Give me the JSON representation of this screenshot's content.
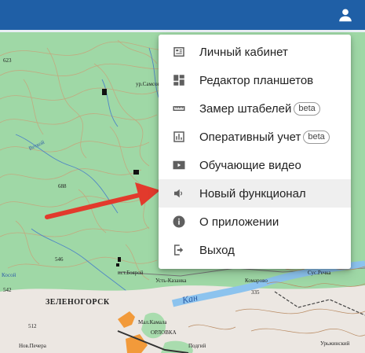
{
  "header": {
    "account_icon": "account-circle-icon",
    "color": "#1f5fa6"
  },
  "menu": {
    "items": [
      {
        "label": "Личный кабинет",
        "icon": "account-card-icon"
      },
      {
        "label": "Редактор планшетов",
        "icon": "dashboard-icon"
      },
      {
        "label": "Замер штабелей",
        "icon": "ruler-icon",
        "badge": "beta"
      },
      {
        "label": "Оперативный учет",
        "icon": "bar-chart-icon",
        "badge": "beta"
      },
      {
        "label": "Обучающие видео",
        "icon": "video-play-icon"
      },
      {
        "label": "Новый функционал",
        "icon": "volume-icon",
        "highlighted": true
      },
      {
        "label": "О приложении",
        "icon": "info-icon"
      },
      {
        "label": "Выход",
        "icon": "logout-icon"
      }
    ]
  },
  "map": {
    "labels": {
      "num_623": "623",
      "num_688": "688",
      "num_546": "546",
      "num_542": "542",
      "num_512": "512",
      "num_335": "335",
      "samson": "ур.Самсон",
      "vetkoy": "Веткой",
      "kosoi": "Косой",
      "boyarov": "ист.Боярой",
      "city": "ЗЕЛЕНОГОРСК",
      "ust_kazanka": "Усть-Казанка",
      "komarovo": "Комарово",
      "sus_rechka": "Сус.Речка",
      "kan_river": "Кан",
      "mal_kamala": "Мал.Камала",
      "orlovka": "ОРЛОВКА",
      "nov_pechera": "Нов.Печера",
      "urzhinsky": "Урьжинский",
      "podzhiy": "Подгий"
    },
    "arrow_color": "#e23a2c"
  }
}
